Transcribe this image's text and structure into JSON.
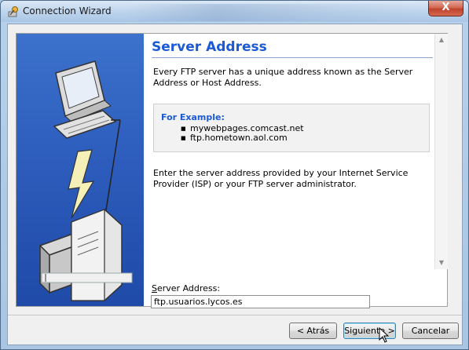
{
  "window": {
    "title": "Connection Wizard",
    "close_glyph": "X"
  },
  "page": {
    "heading": "Server Address",
    "intro": "Every FTP server has a unique address known as the Server Address or Host Address.",
    "example_title": "For Example:",
    "examples": [
      "mywebpages.comcast.net",
      "ftp.hometown.aol.com"
    ],
    "instructions": "Enter the server address provided by your Internet Service Provider (ISP) or your FTP server administrator."
  },
  "form": {
    "server_label_accel": "S",
    "server_label_rest": "erver Address:",
    "server_value": "ftp.usuarios.lycos.es"
  },
  "buttons": {
    "back": "< Atrás",
    "next": "Siguiente >",
    "cancel": "Cancelar"
  },
  "colors": {
    "heading": "#1a5ad6",
    "side_panel": "#2f5fbf"
  }
}
